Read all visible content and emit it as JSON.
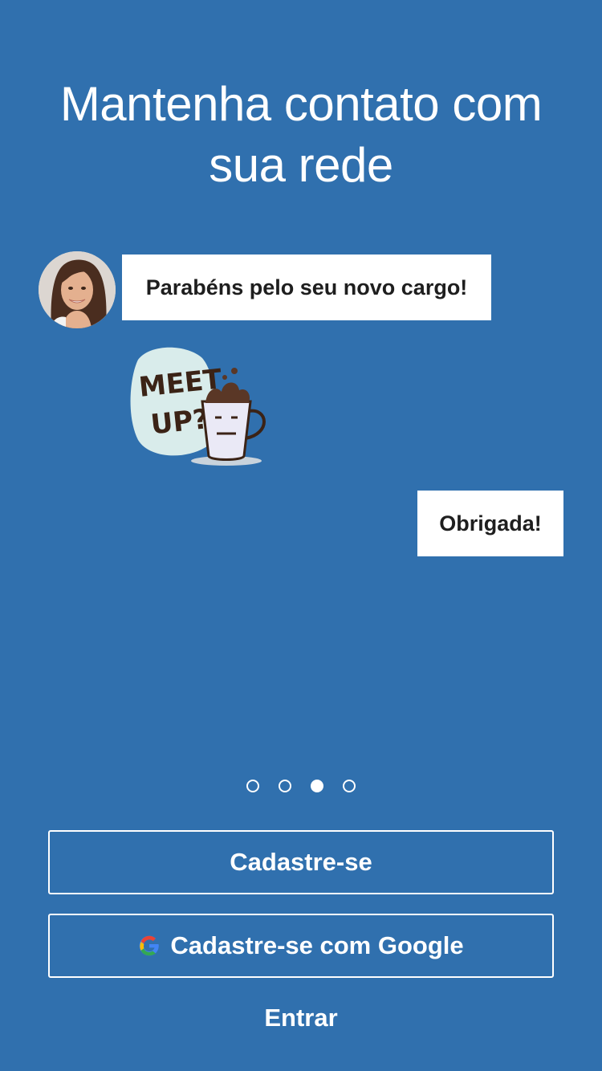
{
  "headline": {
    "line1": "Mantenha contato com",
    "line2": "sua rede"
  },
  "chat": {
    "incoming_message": "Parabéns pelo seu novo cargo!",
    "sticker_text_line1": "MEET",
    "sticker_text_line2": "UP?",
    "outgoing_message": "Obrigada!"
  },
  "pager": {
    "total_pages": 4,
    "current_page": 3
  },
  "actions": {
    "signup_label": "Cadastre-se",
    "google_signup_label": "Cadastre-se com Google",
    "login_label": "Entrar"
  },
  "colors": {
    "background": "#3070ae",
    "bubble": "#ffffff",
    "bubble_text": "#1e1e1e"
  },
  "icons": {
    "avatar": "user-photo",
    "sticker": "coffee-mug-meetup-sticker",
    "google": "google-g-icon"
  }
}
